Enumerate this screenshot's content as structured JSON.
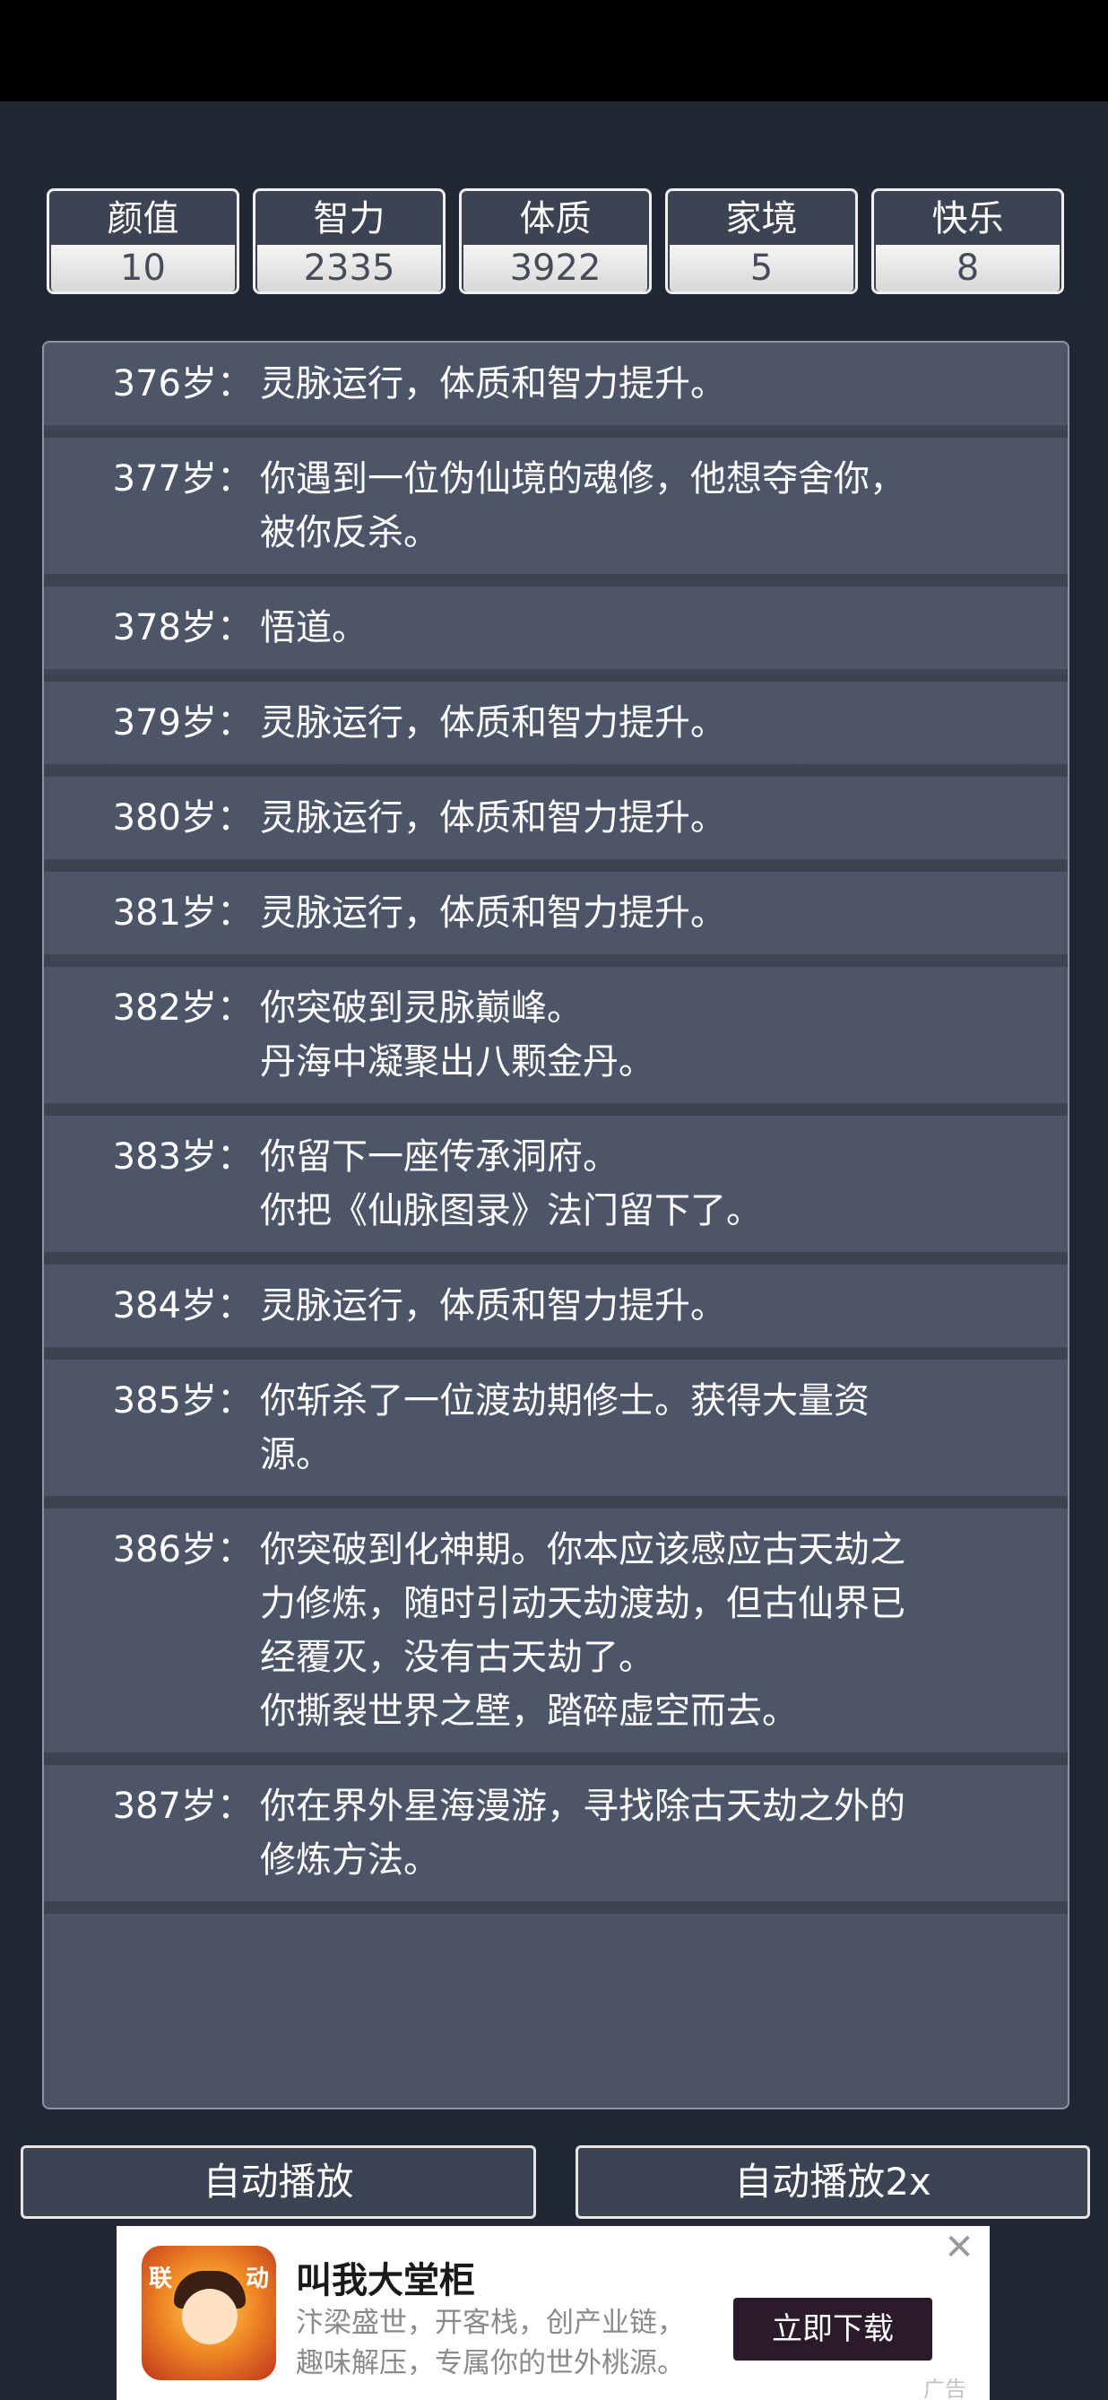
{
  "stats": [
    {
      "name": "颜值",
      "value": "10"
    },
    {
      "name": "智力",
      "value": "2335"
    },
    {
      "name": "体质",
      "value": "3922"
    },
    {
      "name": "家境",
      "value": "5"
    },
    {
      "name": "快乐",
      "value": "8"
    }
  ],
  "events": [
    {
      "age": "376岁：",
      "lines": [
        "灵脉运行，体质和智力提升。"
      ]
    },
    {
      "age": "377岁：",
      "lines": [
        "你遇到一位伪仙境的魂修，他想夺舍你，",
        "被你反杀。"
      ]
    },
    {
      "age": "378岁：",
      "lines": [
        "悟道。"
      ]
    },
    {
      "age": "379岁：",
      "lines": [
        "灵脉运行，体质和智力提升。"
      ]
    },
    {
      "age": "380岁：",
      "lines": [
        "灵脉运行，体质和智力提升。"
      ]
    },
    {
      "age": "381岁：",
      "lines": [
        "灵脉运行，体质和智力提升。"
      ]
    },
    {
      "age": "382岁：",
      "lines": [
        "你突破到灵脉巅峰。",
        "丹海中凝聚出八颗金丹。"
      ]
    },
    {
      "age": "383岁：",
      "lines": [
        "你留下一座传承洞府。",
        "你把《仙脉图录》法门留下了。"
      ]
    },
    {
      "age": "384岁：",
      "lines": [
        "灵脉运行，体质和智力提升。"
      ]
    },
    {
      "age": "385岁：",
      "lines": [
        "你斩杀了一位渡劫期修士。获得大量资",
        "源。"
      ]
    },
    {
      "age": "386岁：",
      "lines": [
        "你突破到化神期。你本应该感应古天劫之",
        "力修炼，随时引动天劫渡劫，但古仙界已",
        "经覆灭，没有古天劫了。",
        "你撕裂世界之壁，踏碎虚空而去。"
      ]
    },
    {
      "age": "387岁：",
      "lines": [
        "你在界外星海漫游，寻找除古天劫之外的",
        "修炼方法。"
      ]
    }
  ],
  "buttons": {
    "auto_play": "自动播放",
    "auto_play_2x": "自动播放2x"
  },
  "ad": {
    "title": "叫我大堂柜",
    "desc_line1": "汴梁盛世，开客栈，创产业链，",
    "desc_line2": "趣味解压，专属你的世外桃源。",
    "cta": "立即下载",
    "label": "广告",
    "icon_left": "联",
    "icon_right": "动",
    "close_icon": "close-icon"
  },
  "colors": {
    "background": "#212733",
    "panel": "#4d5669",
    "stat_value_text": "#464c59"
  }
}
